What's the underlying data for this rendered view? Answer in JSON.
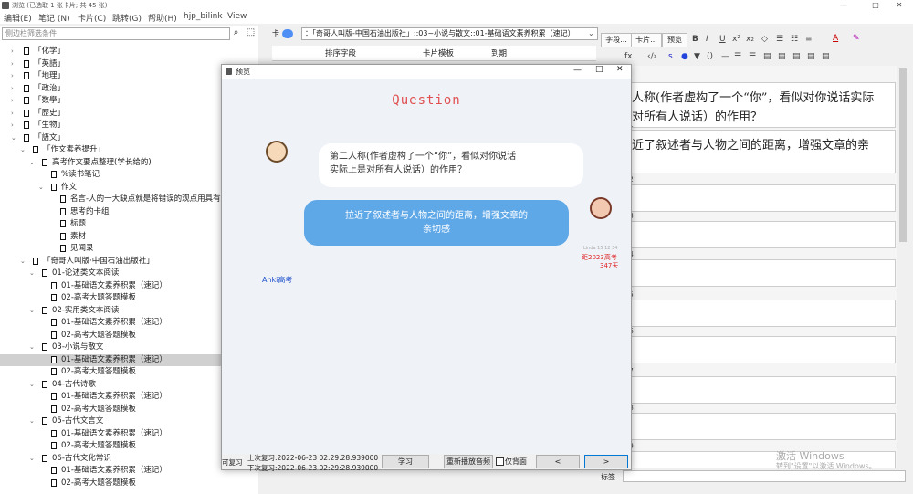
{
  "window": {
    "title": "浏览 (已选取 1 张卡片; 共 45 张)",
    "min": "—",
    "max": "□",
    "close": "✕"
  },
  "menu": [
    "编辑(E)",
    "笔记 (N)",
    "卡片(C)",
    "跳转(G)",
    "帮助(H)",
    "hjp_bilink",
    "View"
  ],
  "sidebar": {
    "filter_placeholder": "侧边栏筛选条件",
    "rows": [
      {
        "label": "「化学」",
        "level": 1,
        "arrow": "›"
      },
      {
        "label": "「英語」",
        "level": 1,
        "arrow": "›"
      },
      {
        "label": "「地理」",
        "level": 1,
        "arrow": "›"
      },
      {
        "label": "「政治」",
        "level": 1,
        "arrow": "›"
      },
      {
        "label": "「数學」",
        "level": 1,
        "arrow": "›"
      },
      {
        "label": "「歷史」",
        "level": 1,
        "arrow": "›"
      },
      {
        "label": "「生物」",
        "level": 1,
        "arrow": "›"
      },
      {
        "label": "「語文」",
        "level": 1,
        "arrow": "⌄"
      },
      {
        "label": "「作文素养提升」",
        "level": 2,
        "arrow": "⌄"
      },
      {
        "label": "高考作文要点整理(学长给的)",
        "level": 3,
        "arrow": "⌄"
      },
      {
        "label": "%读书笔记",
        "level": 4,
        "arrow": ""
      },
      {
        "label": "作文",
        "level": 4,
        "arrow": "⌄"
      },
      {
        "label": "名言-人的一大缺点就是将错误的观点用具有诗",
        "level": 5,
        "arrow": ""
      },
      {
        "label": "思考的卡组",
        "level": 5,
        "arrow": ""
      },
      {
        "label": "标题",
        "level": 5,
        "arrow": ""
      },
      {
        "label": "素材",
        "level": 5,
        "arrow": ""
      },
      {
        "label": "见闻录",
        "level": 5,
        "arrow": ""
      },
      {
        "label": "「奇哥人叫版·中国石油出版社」",
        "level": 2,
        "arrow": "⌄"
      },
      {
        "label": "01-论述类文本阅读",
        "level": 3,
        "arrow": "⌄"
      },
      {
        "label": "01-基础语文素养积累（速记）",
        "level": 4,
        "arrow": ""
      },
      {
        "label": "02-高考大题答题模板",
        "level": 4,
        "arrow": ""
      },
      {
        "label": "02-实用类文本阅读",
        "level": 3,
        "arrow": "⌄"
      },
      {
        "label": "01-基础语文素养积累（速记）",
        "level": 4,
        "arrow": ""
      },
      {
        "label": "02-高考大题答题模板",
        "level": 4,
        "arrow": ""
      },
      {
        "label": "03-小说与散文",
        "level": 3,
        "arrow": "⌄"
      },
      {
        "label": "01-基础语文素养积累（速记）",
        "level": 4,
        "arrow": "",
        "selected": true
      },
      {
        "label": "02-高考大题答题模板",
        "level": 4,
        "arrow": ""
      },
      {
        "label": "04-古代诗歌",
        "level": 3,
        "arrow": "⌄"
      },
      {
        "label": "01-基础语文素养积累（速记）",
        "level": 4,
        "arrow": ""
      },
      {
        "label": "02-高考大题答题模板",
        "level": 4,
        "arrow": ""
      },
      {
        "label": "05-古代文言文",
        "level": 3,
        "arrow": "⌄"
      },
      {
        "label": "01-基础语文素养积累（速记）",
        "level": 4,
        "arrow": ""
      },
      {
        "label": "02-高考大题答题模板",
        "level": 4,
        "arrow": ""
      },
      {
        "label": "06-古代文化常识",
        "level": 3,
        "arrow": "⌄"
      },
      {
        "label": "01-基础语文素养积累（速记）",
        "level": 4,
        "arrow": ""
      },
      {
        "label": "02-高考大题答题模板",
        "level": 4,
        "arrow": ""
      }
    ]
  },
  "browser": {
    "toggle_label": "卡",
    "search_query": "：「奇哥人叫版-中国石油出版社」::03~小说与散文::01-基础语文素养积累（速记）",
    "columns": [
      "排序字段",
      "卡片模板",
      "到期"
    ],
    "buttons": [
      "字段...",
      "卡片...",
      "预览"
    ]
  },
  "editor": {
    "fields": [
      {
        "num": "",
        "text_lines": [
          "人称(作者虚构了一个“你”，看似对你说话实际",
          "对所有人说话）的作用？"
        ]
      },
      {
        "num": "1",
        "text_lines": [
          "近了叙述者与人物之间的距离，增强文章的亲"
        ]
      },
      {
        "num": "2",
        "text_lines": []
      },
      {
        "num": "3",
        "text_lines": []
      },
      {
        "num": "4",
        "text_lines": []
      },
      {
        "num": "5",
        "text_lines": []
      },
      {
        "num": "6",
        "text_lines": []
      },
      {
        "num": "7",
        "text_lines": []
      },
      {
        "num": "8",
        "text_lines": []
      },
      {
        "num": "9",
        "text_lines": []
      }
    ],
    "tags_label": "标签"
  },
  "preview": {
    "title": "预览",
    "question_title": "Question",
    "question": [
      "第二人称(作者虚构了一个“你”，看似对你说话",
      "实际上是对所有人说话）的作用？"
    ],
    "answer": [
      "拉近了叙述者与人物之间的距离，增强文章的",
      "亲切感"
    ],
    "countdown_small": "Linda 15 12 34",
    "countdown_red": "距2023高考",
    "countdown_days": "347天",
    "ank_label": "Anki高考",
    "last_review_1": "上次复习:2022-06-23 02:29:28.939000",
    "last_review_2": "下次复习:2022-06-23 02:29:28.939000",
    "can_review": "可复习",
    "btn_review": "学习",
    "btn_replay": "重新播放音频",
    "checkbox_back": "仅背面",
    "btn_prev": "<",
    "btn_next": ">"
  },
  "watermark": {
    "line1": "激活 Windows",
    "line2": "转到\"设置\"以激活 Windows。"
  },
  "colors": {
    "accent": "#4f8ff5",
    "answer_bubble": "#5fa8e8",
    "question_title": "#e05050"
  }
}
